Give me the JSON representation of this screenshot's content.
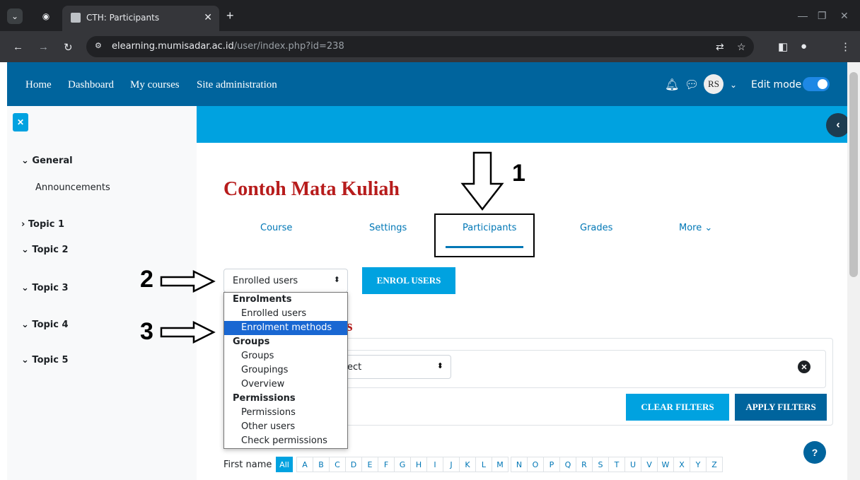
{
  "browser": {
    "tab_title": "CTH: Participants",
    "url_host": "elearning.mumisadar.ac.id",
    "url_path": "/user/index.php?id=238"
  },
  "navbar": {
    "links": [
      "Home",
      "Dashboard",
      "My courses",
      "Site administration"
    ],
    "avatar_initials": "RS",
    "edit_mode_label": "Edit mode",
    "edit_mode_on": true
  },
  "drawer": {
    "sections": [
      {
        "label": "General",
        "expanded": true
      },
      {
        "label": "Topic 1",
        "expanded": false
      },
      {
        "label": "Topic 2",
        "expanded": true
      },
      {
        "label": "Topic 3",
        "expanded": true
      },
      {
        "label": "Topic 4",
        "expanded": true
      },
      {
        "label": "Topic 5",
        "expanded": true
      }
    ],
    "items": [
      "Announcements"
    ]
  },
  "course": {
    "title": "Contoh Mata Kuliah",
    "tabs": [
      "Course",
      "Settings",
      "Participants",
      "Grades",
      "More"
    ],
    "active_tab": "Participants"
  },
  "enrol": {
    "select_value": "Enrolled users",
    "button_label": "ENROL USERS",
    "heading_fragment": "s"
  },
  "dropdown": {
    "groups": [
      {
        "label": "Enrolments",
        "options": [
          "Enrolled users",
          "Enrolment methods"
        ]
      },
      {
        "label": "Groups",
        "options": [
          "Groups",
          "Groupings",
          "Overview"
        ]
      },
      {
        "label": "Permissions",
        "options": [
          "Permissions",
          "Other users",
          "Check permissions"
        ]
      }
    ],
    "selected": "Enrolment methods"
  },
  "filters": {
    "match_value": "ect",
    "clear_label": "CLEAR FILTERS",
    "apply_label": "APPLY FILTERS"
  },
  "initials_bar": {
    "label": "First name",
    "all_label": "All",
    "letters": [
      "A",
      "B",
      "C",
      "D",
      "E",
      "F",
      "G",
      "H",
      "I",
      "J",
      "K",
      "L",
      "M",
      "N",
      "O",
      "P",
      "Q",
      "R",
      "S",
      "T",
      "U",
      "V",
      "W",
      "X",
      "Y",
      "Z"
    ]
  },
  "annotations": {
    "one": "1",
    "two": "2",
    "three": "3"
  },
  "help_label": "?"
}
